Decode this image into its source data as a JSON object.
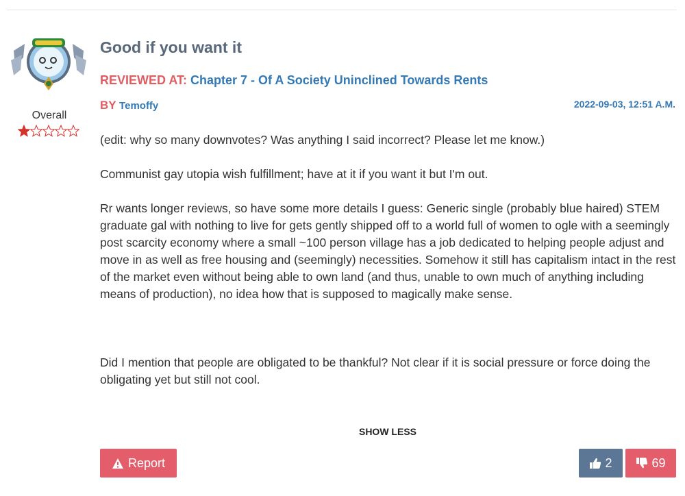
{
  "review": {
    "title": "Good if you want it",
    "reviewed_at_prefix": "REVIEWED AT:",
    "chapter": "Chapter 7 - Of A Society Uninclined Towards Rents",
    "by_prefix": "BY",
    "author": "Temoffy",
    "date": "2022-09-03, 12:51 A.M.",
    "body": [
      "(edit: why so many downvotes? Was anything I said incorrect? Please let me know.)",
      "Communist gay utopia wish fulfillment; have at it if you want it but I'm out.",
      "Rr wants longer reviews, so have some more details I guess: Generic single (probably blue haired) STEM graduate gal with nothing to live for gets gently shipped off to a world full of women to ogle with a seemingly post scarcity economy where a small ~100 person village has a job dedicated to helping people adjust and move in as well as free housing and (seemingly) necessities. Somehow it still has capitalism intact in the rest of the market even without being able to own land (and thus, unable to own much of anything including means of production), no idea how that is supposed to magically make sense.",
      "Did I mention that people are obligated to be thankful? Not clear if it is social pressure or force doing the obligating yet but still not cool."
    ]
  },
  "rating": {
    "label": "Overall",
    "value": 1,
    "max": 5
  },
  "actions": {
    "show_less": "SHOW LESS",
    "report": "Report",
    "upvotes": "2",
    "downvotes": "69"
  },
  "colors": {
    "title": "#58677a",
    "accent_red": "#e05d63",
    "link_blue": "#337ab7",
    "upvote_bg": "#5c7696",
    "downvote_bg": "#e35d6a"
  },
  "icons": {
    "avatar": "avatar-image",
    "report": "warning-icon",
    "upvote": "thumbs-up-icon",
    "downvote": "thumbs-down-icon",
    "star": "star-icon"
  }
}
